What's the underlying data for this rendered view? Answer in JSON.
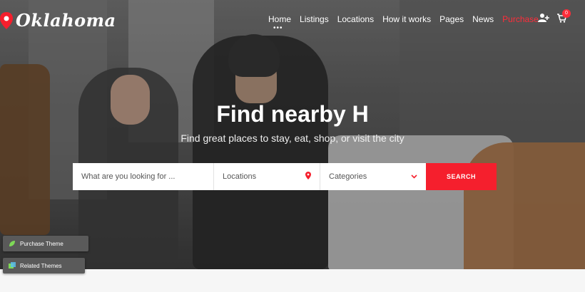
{
  "brand": {
    "name": "Oklahoma",
    "accent": "#f51f2d"
  },
  "nav": {
    "items": [
      {
        "label": "Home"
      },
      {
        "label": "Listings"
      },
      {
        "label": "Locations"
      },
      {
        "label": "How it works"
      },
      {
        "label": "Pages"
      },
      {
        "label": "News"
      },
      {
        "label": "Purchase"
      }
    ],
    "active_indicator": "•••",
    "cart_count": "0"
  },
  "hero": {
    "title": "Find nearby H",
    "subtitle": "Find great places to stay, eat, shop, or visit the city"
  },
  "search": {
    "what_placeholder": "What are you looking for ...",
    "location_label": "Locations",
    "category_label": "Categories",
    "button_label": "SEARCH"
  },
  "widgets": {
    "purchase_theme": "Purchase Theme",
    "related_themes": "Related Themes"
  },
  "icons": [
    "map-pin-icon",
    "add-user-icon",
    "cart-icon",
    "location-pin-icon",
    "chevron-down-icon",
    "leaf-icon",
    "themes-icon"
  ]
}
